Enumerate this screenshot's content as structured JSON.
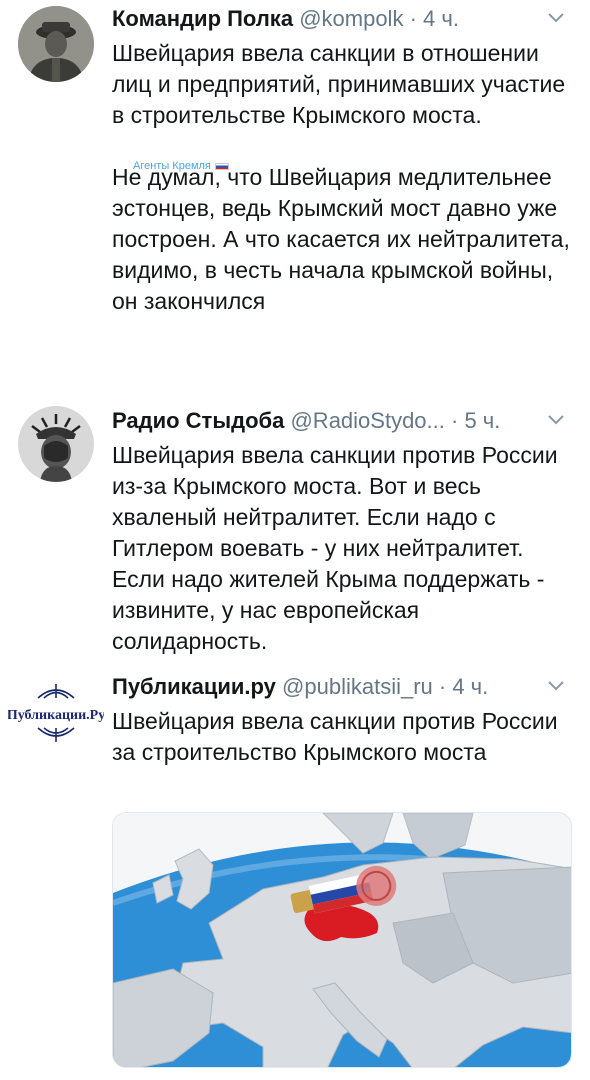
{
  "tweets": [
    {
      "name": "Командир Полка",
      "handle": "@kompolk",
      "time": "· 4 ч.",
      "text": [
        "Швейцария ввела санкции в отношении лиц и предприятий, принимавших участие в строительстве Крымского моста.",
        "",
        "Не думал, что Швейцария медлительнее эстонцев, ведь Крымский мост давно уже построен. А что касается их нейтралитета, видимо, в честь начала крымской войны, он закончился"
      ],
      "watermark": "Агенты Кремля"
    },
    {
      "name": "Радио Стыдоба",
      "handle": "@RadioStydo...",
      "time": "· 5 ч.",
      "text": [
        "Швейцария ввела санкции против России из-за Крымского моста. Вот и весь хваленый нейтралитет. Если надо с Гитлером воевать - у них нейтралитет. Если надо жителей Крыма поддержать - извините, у нас европейская солидарность."
      ]
    },
    {
      "name": "Публикации.ру",
      "handle": "@publikatsii_ru",
      "time": "· 4 ч.",
      "text": [
        "Швейцария ввела санкции против России за строительство Крымского моста"
      ],
      "avatar_text": "Публикации.Ру"
    }
  ],
  "icons": {
    "caret": "chevron-down-icon"
  },
  "colors": {
    "text": "#14171a",
    "secondary": "#657786",
    "ocean": "#2e8fd6",
    "land": "#d9dde2"
  }
}
